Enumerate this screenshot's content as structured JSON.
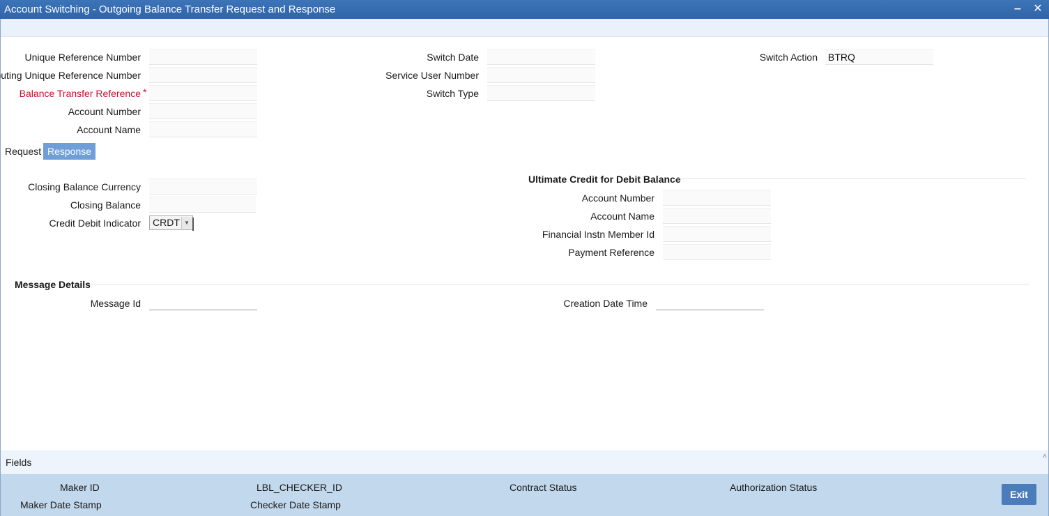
{
  "window": {
    "title": "Account Switching - Outgoing Balance Transfer Request and Response",
    "minimize_glyph": "‒",
    "close_glyph": "✕"
  },
  "header_fields": {
    "unique_reference_number": {
      "label": "Unique Reference Number",
      "value": ""
    },
    "routing_unique_reference_number": {
      "label": "Routing Unique Reference Number",
      "value": ""
    },
    "balance_transfer_reference": {
      "label": "Balance Transfer Reference",
      "value": "",
      "required_mark": "*"
    },
    "account_number": {
      "label": "Account Number",
      "value": ""
    },
    "account_name": {
      "label": "Account Name",
      "value": ""
    },
    "switch_date": {
      "label": "Switch Date",
      "value": ""
    },
    "service_user_number": {
      "label": "Service User Number",
      "value": ""
    },
    "switch_type": {
      "label": "Switch Type",
      "value": ""
    },
    "switch_action": {
      "label": "Switch Action",
      "value": "BTRQ"
    }
  },
  "tabs": [
    {
      "label": "Request",
      "active": false
    },
    {
      "label": "Response",
      "active": true
    }
  ],
  "response": {
    "closing_balance_currency": {
      "label": "Closing Balance Currency",
      "value": ""
    },
    "closing_balance": {
      "label": "Closing Balance",
      "value": ""
    },
    "credit_debit_indicator": {
      "label": "Credit Debit Indicator",
      "value": "CRDT"
    },
    "ultimate_credit": {
      "heading": "Ultimate Credit for Debit Balance",
      "account_number": {
        "label": "Account Number",
        "value": ""
      },
      "account_name": {
        "label": "Account Name",
        "value": ""
      },
      "financial_instn_member_id": {
        "label": "Financial Instn Member Id",
        "value": ""
      },
      "payment_reference": {
        "label": "Payment Reference",
        "value": ""
      }
    }
  },
  "message_details": {
    "heading": "Message Details",
    "message_id": {
      "label": "Message Id",
      "value": ""
    },
    "creation_date_time": {
      "label": "Creation Date Time",
      "value": ""
    }
  },
  "fields_bar": {
    "label": "Fields",
    "chevron": "˄"
  },
  "footer": {
    "maker_id": "Maker ID",
    "maker_date_stamp": "Maker Date Stamp",
    "checker_id": "LBL_CHECKER_ID",
    "checker_date_stamp": "Checker Date Stamp",
    "contract_status": "Contract Status",
    "authorization_status": "Authorization Status",
    "exit_label": "Exit"
  },
  "colors": {
    "title_bar": "#3d74b8",
    "required": "#c8102e",
    "active_tab": "#6f9fd8",
    "footer": "#c2d8ec",
    "exit_button": "#4c7dbb"
  }
}
